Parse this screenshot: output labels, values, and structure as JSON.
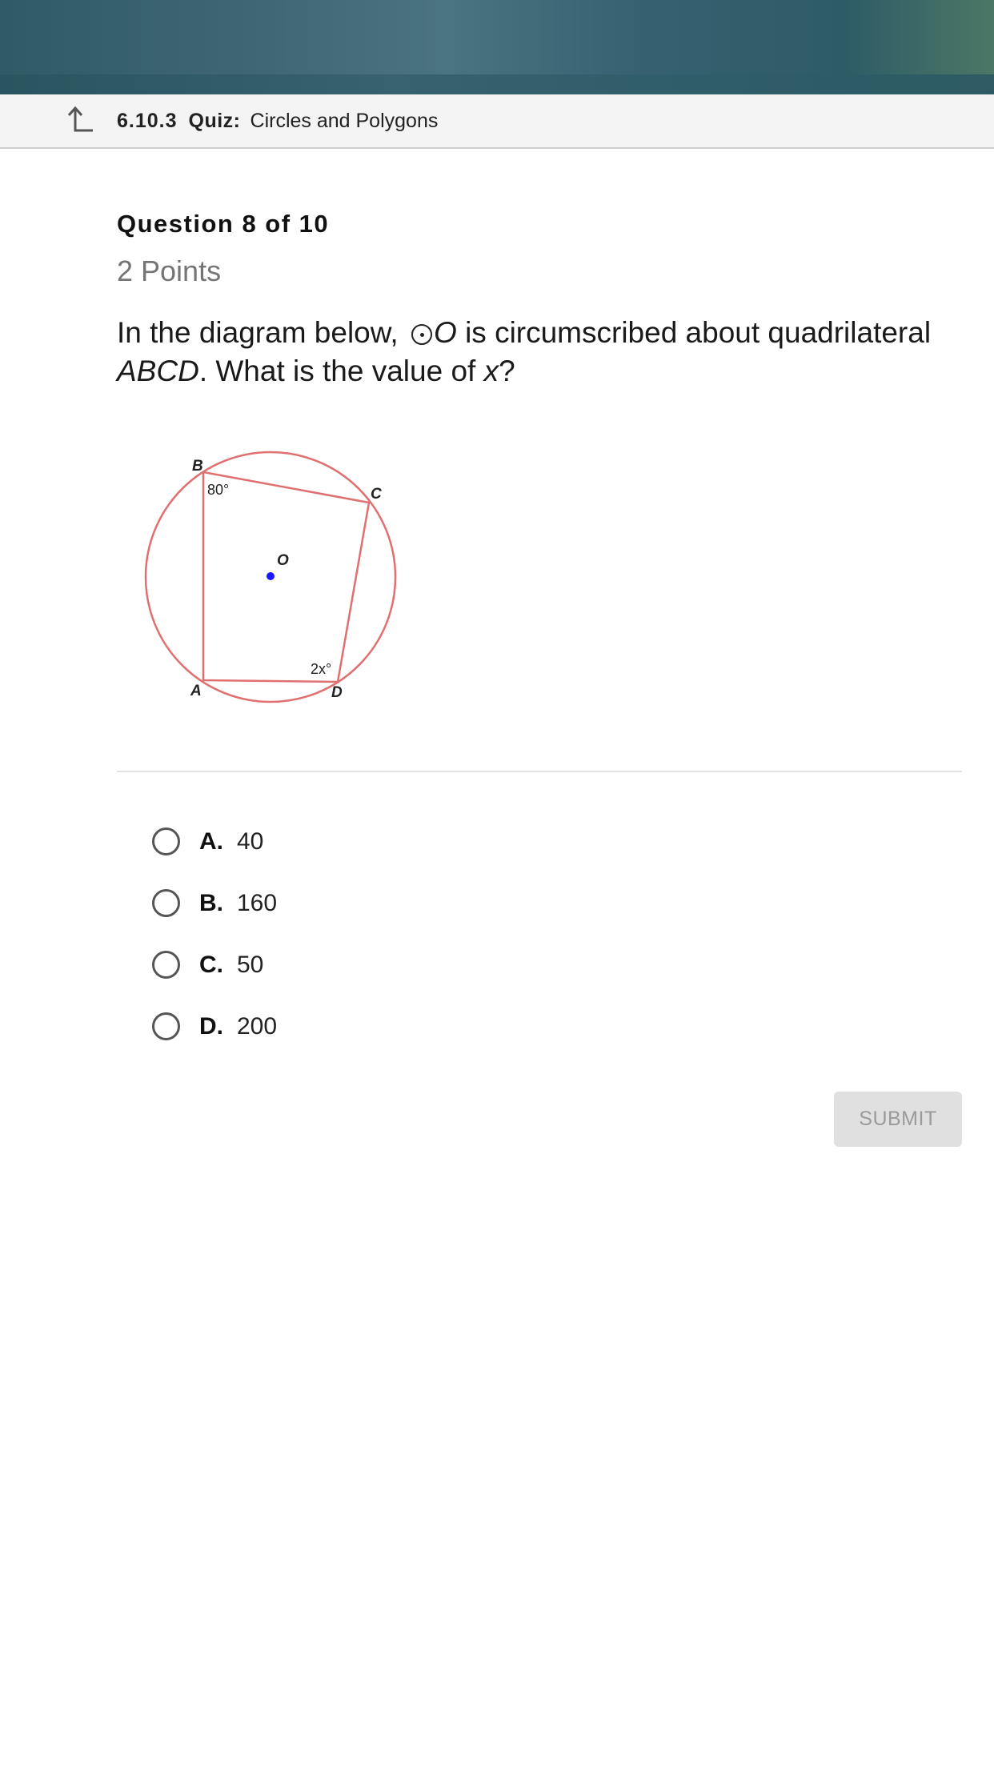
{
  "header": {
    "breadcrumb_number": "6.10.3",
    "breadcrumb_quiz": "Quiz:",
    "breadcrumb_title": "Circles and Polygons"
  },
  "question": {
    "header": "Question 8 of 10",
    "points": "2 Points",
    "text_part1": "In the diagram below,",
    "circle_name": "O",
    "text_part2": "is circumscribed about quadrilateral",
    "quad_name": "ABCD",
    "text_part3": ". What is the value of",
    "variable": "x",
    "text_part4": "?"
  },
  "diagram": {
    "label_b": "B",
    "label_c": "C",
    "label_o": "O",
    "label_a": "A",
    "label_d": "D",
    "angle_b": "80°",
    "angle_d": "2x°",
    "stroke_color": "#e07070",
    "center_color": "#1a1aff"
  },
  "choices": [
    {
      "letter": "A.",
      "value": "40"
    },
    {
      "letter": "B.",
      "value": "160"
    },
    {
      "letter": "C.",
      "value": "50"
    },
    {
      "letter": "D.",
      "value": "200"
    }
  ],
  "submit_label": "SUBMIT"
}
